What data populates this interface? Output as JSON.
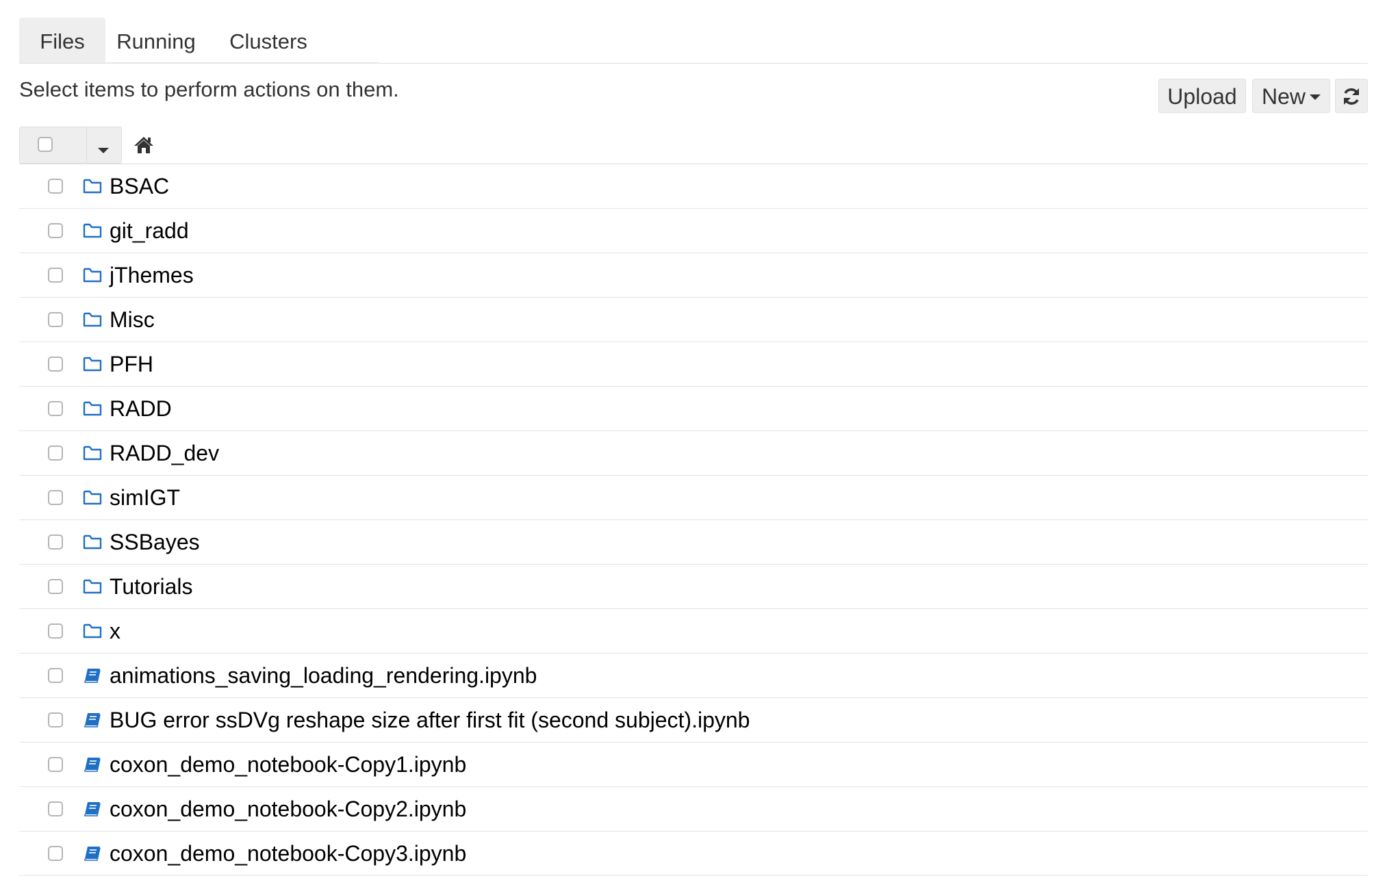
{
  "tabs": [
    {
      "label": "Files",
      "active": true
    },
    {
      "label": "Running",
      "active": false
    },
    {
      "label": "Clusters",
      "active": false
    }
  ],
  "toolbar": {
    "hint": "Select items to perform actions on them.",
    "upload_label": "Upload",
    "new_label": "New",
    "refresh_icon": "refresh-icon"
  },
  "breadcrumb": {
    "home_icon": "home-icon"
  },
  "colors": {
    "icon_blue": "#1f6fc5",
    "tab_active_bg": "#eeeeee",
    "button_bg": "#eeeeee",
    "row_divider": "#e4e4e4"
  },
  "items": [
    {
      "type": "folder",
      "name": "BSAC"
    },
    {
      "type": "folder",
      "name": "git_radd"
    },
    {
      "type": "folder",
      "name": "jThemes"
    },
    {
      "type": "folder",
      "name": "Misc"
    },
    {
      "type": "folder",
      "name": "PFH"
    },
    {
      "type": "folder",
      "name": "RADD"
    },
    {
      "type": "folder",
      "name": "RADD_dev"
    },
    {
      "type": "folder",
      "name": "simIGT"
    },
    {
      "type": "folder",
      "name": "SSBayes"
    },
    {
      "type": "folder",
      "name": "Tutorials"
    },
    {
      "type": "folder",
      "name": "x"
    },
    {
      "type": "notebook",
      "name": "animations_saving_loading_rendering.ipynb"
    },
    {
      "type": "notebook",
      "name": "BUG error ssDVg reshape size after first fit (second subject).ipynb"
    },
    {
      "type": "notebook",
      "name": "coxon_demo_notebook-Copy1.ipynb"
    },
    {
      "type": "notebook",
      "name": "coxon_demo_notebook-Copy2.ipynb"
    },
    {
      "type": "notebook",
      "name": "coxon_demo_notebook-Copy3.ipynb"
    }
  ]
}
